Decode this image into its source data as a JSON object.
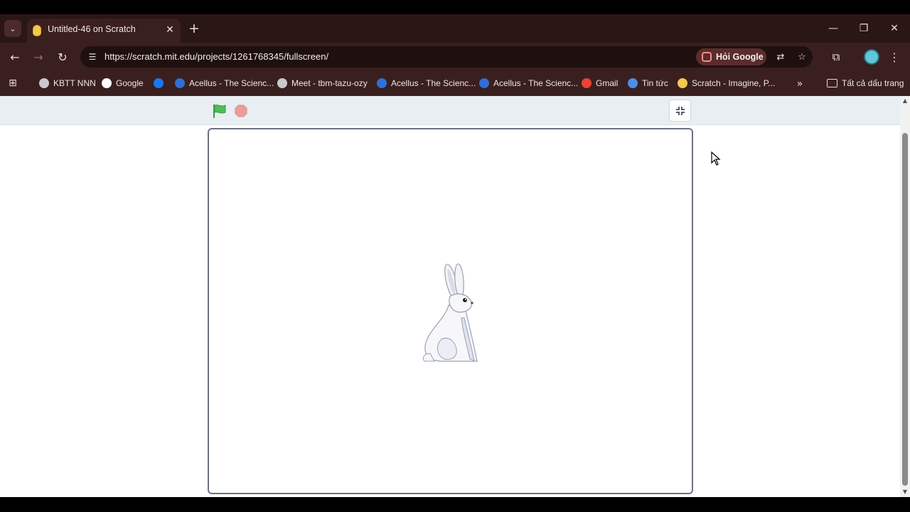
{
  "tab": {
    "title": "Untitled-46 on Scratch"
  },
  "toolbar": {
    "url": "https://scratch.mit.edu/projects/1261768345/fullscreen/",
    "ask_google_label": "Hỏi Google"
  },
  "bookmarks": [
    {
      "label": "KBTT NNN",
      "icon": "globe-icon",
      "color": "#c9c9c9"
    },
    {
      "label": "Google",
      "icon": "google-icon",
      "color": "#ffffff"
    },
    {
      "label": "",
      "icon": "facebook-icon",
      "color": "#1877f2"
    },
    {
      "label": "Acellus - The Scienc...",
      "icon": "acellus-icon",
      "color": "#2f6fd6"
    },
    {
      "label": "Meet - tbm-tazu-ozy",
      "icon": "globe-icon",
      "color": "#c9c9c9"
    },
    {
      "label": "Acellus - The Scienc...",
      "icon": "acellus-icon",
      "color": "#2f6fd6"
    },
    {
      "label": "Acellus - The Scienc...",
      "icon": "acellus-icon",
      "color": "#2f6fd6"
    },
    {
      "label": "Gmail",
      "icon": "gmail-icon",
      "color": "#ea4335"
    },
    {
      "label": "Tin tức",
      "icon": "news-icon",
      "color": "#4a8fe7"
    },
    {
      "label": "Scratch - Imagine, P...",
      "icon": "scratch-icon",
      "color": "#f2c94c"
    }
  ],
  "bookmarks_folder": "Tất cả dấu trang",
  "colors": {
    "flag_green": "#4cbf56",
    "stop_red": "#ec9c9c"
  }
}
